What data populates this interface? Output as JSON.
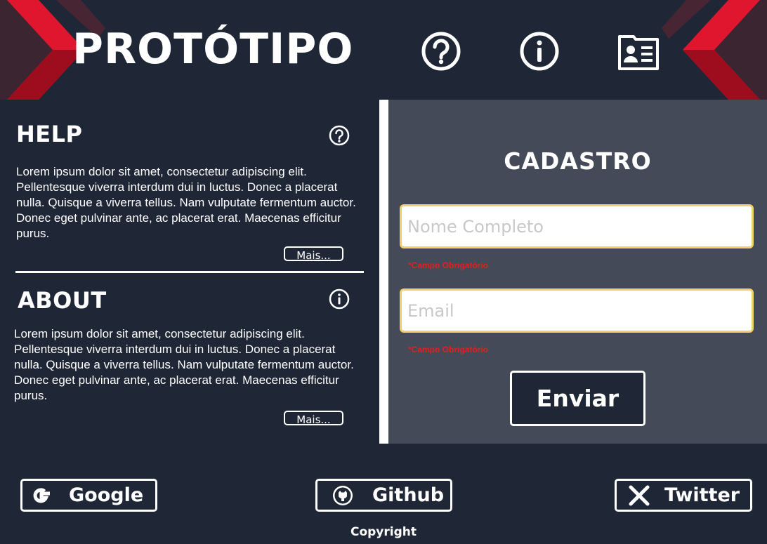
{
  "header": {
    "title": "PROTÓTIPO",
    "icons": [
      "help-icon",
      "info-icon",
      "contact-card-icon"
    ],
    "accent_color": "#e0162f"
  },
  "help": {
    "title": "HELP",
    "text": "Lorem ipsum dolor sit amet, consectetur adipiscing elit. Pellentesque viverra interdum dui in luctus. Donec a placerat nulla. Quisque a viverra tellus. Nam vulputate fermentum auctor. Donec eget pulvinar ante, ac placerat erat. Maecenas efficitur purus.",
    "more_label": "Mais..."
  },
  "about": {
    "title": "ABOUT",
    "text": "Lorem ipsum dolor sit amet, consectetur adipiscing elit. Pellentesque viverra interdum dui in luctus. Donec a placerat nulla. Quisque a viverra tellus. Nam vulputate fermentum auctor. Donec eget pulvinar ante, ac placerat erat. Maecenas efficitur purus.",
    "more_label": "Mais..."
  },
  "form": {
    "title": "CADASTRO",
    "name_placeholder": "Nome Completo",
    "name_value": "",
    "email_placeholder": "Email",
    "email_value": "",
    "required_text": "*Campo Obrigatório",
    "submit_label": "Enviar"
  },
  "footer": {
    "google_label": "Google",
    "github_label": "Github",
    "twitter_label": "Twitter",
    "copyright": "Copyright"
  }
}
